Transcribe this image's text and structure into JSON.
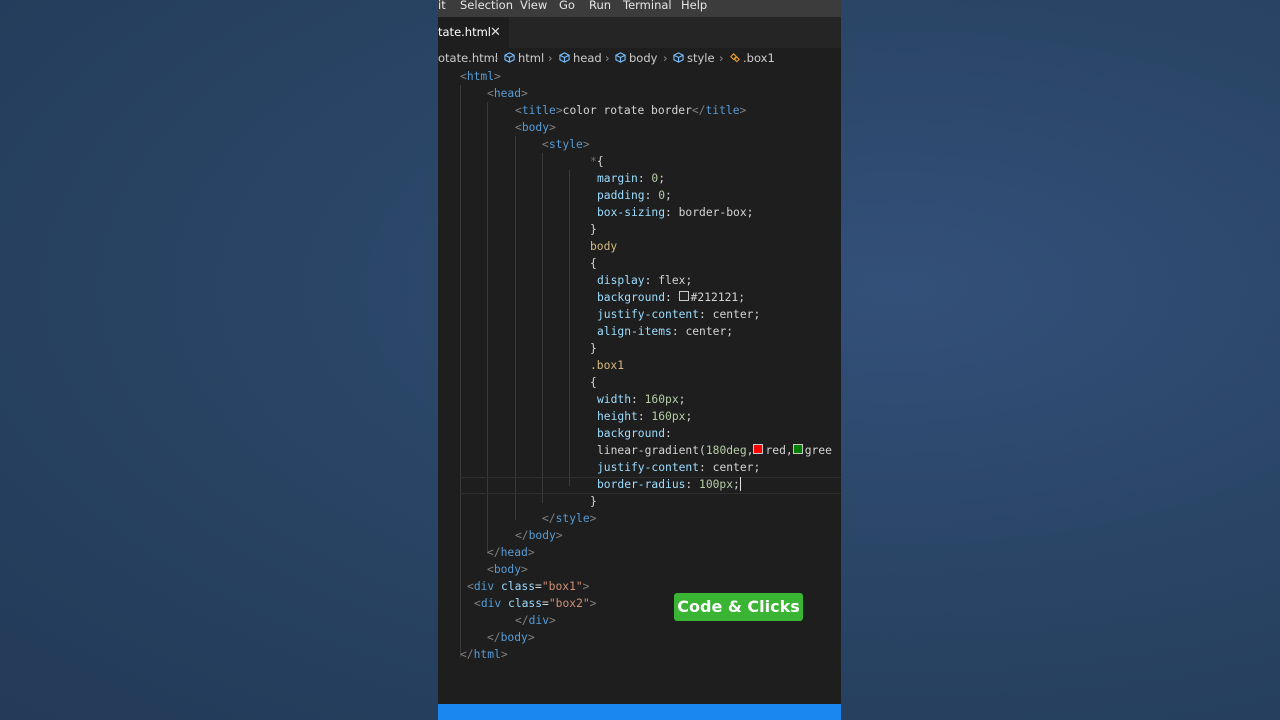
{
  "menu": [
    "it",
    "Selection",
    "View",
    "Go",
    "Run",
    "Terminal",
    "Help"
  ],
  "tab": {
    "label": "tate.html",
    "close_glyph": "✕"
  },
  "breadcrumb": {
    "file": "otate.html",
    "items": [
      "html",
      "head",
      "body",
      "style",
      ".box1"
    ]
  },
  "code": {
    "html_open": "html",
    "head_open": "head",
    "title_tag": "title",
    "title_text": "color rotate border",
    "body_tag": "body",
    "style_tag": "style",
    "univ_sel": "*",
    "univ_brace": "{",
    "margin_prop": "margin",
    "margin_val": "0",
    "padding_prop": "padding",
    "padding_val": "0",
    "boxsizing_prop": "box-sizing",
    "boxsizing_val": "border-box",
    "close_brace": "}",
    "body_sel": "body",
    "open_brace": "{",
    "display_prop": "display",
    "display_val": "flex",
    "background_prop": "background",
    "background_val": "#212121",
    "justify_prop": "justify-content",
    "justify_val": "center",
    "align_prop": "align-items",
    "align_val": "center",
    "box1_sel": ".box1",
    "width_prop": "width",
    "width_val": "160px",
    "height_prop": "height",
    "height_val": "160px",
    "gradient_fn": "linear-gradient",
    "gradient_deg": "180deg",
    "gradient_c1": "red",
    "gradient_c2": "gree",
    "radius_prop": "border-radius",
    "radius_val": "100px",
    "div_tag": "div",
    "class_attr": "class",
    "box1_class": "\"box1\"",
    "box2_class": "\"box2\""
  },
  "swatches": {
    "bg": "#212121",
    "red": "#ff0000",
    "green": "#008000"
  },
  "badge": "Code & Clicks",
  "colors": {
    "editor_bg": "#1e1e1e",
    "status_bar": "#1a86f0",
    "badge_bg": "#39b433"
  }
}
